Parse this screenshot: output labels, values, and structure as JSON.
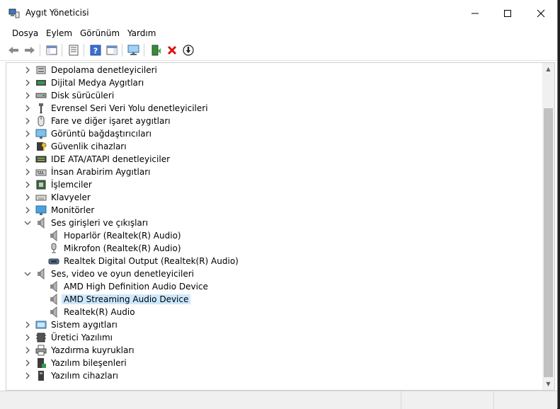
{
  "window": {
    "title": "Aygıt Yöneticisi"
  },
  "menu": {
    "items": [
      "Dosya",
      "Eylem",
      "Görünüm",
      "Yardım"
    ]
  },
  "toolbar": {
    "icons": [
      "back-icon",
      "forward-icon",
      "show-hide-tree-icon",
      "properties-icon",
      "help-icon",
      "action-pane-icon",
      "monitor-icon",
      "update-driver-icon",
      "uninstall-icon",
      "disable-device-icon"
    ]
  },
  "tree": {
    "items": [
      {
        "label": "Depolama denetleyicileri",
        "level": 0,
        "expanded": false,
        "icon": "storage-controller-icon"
      },
      {
        "label": "Dijital Medya Aygıtları",
        "level": 0,
        "expanded": false,
        "icon": "digital-media-icon"
      },
      {
        "label": "Disk sürücüleri",
        "level": 0,
        "expanded": false,
        "icon": "disk-drive-icon"
      },
      {
        "label": "Evrensel Seri Veri Yolu denetleyicileri",
        "level": 0,
        "expanded": false,
        "icon": "usb-icon"
      },
      {
        "label": "Fare ve diğer işaret aygıtları",
        "level": 0,
        "expanded": false,
        "icon": "mouse-icon"
      },
      {
        "label": "Görüntü bağdaştırıcıları",
        "level": 0,
        "expanded": false,
        "icon": "display-adapter-icon"
      },
      {
        "label": "Güvenlik cihazları",
        "level": 0,
        "expanded": false,
        "icon": "security-device-icon"
      },
      {
        "label": "IDE ATA/ATAPI denetleyiciler",
        "level": 0,
        "expanded": false,
        "icon": "ide-controller-icon"
      },
      {
        "label": "İnsan Arabirim Aygıtları",
        "level": 0,
        "expanded": false,
        "icon": "hid-icon"
      },
      {
        "label": "İşlemciler",
        "level": 0,
        "expanded": false,
        "icon": "processor-icon"
      },
      {
        "label": "Klavyeler",
        "level": 0,
        "expanded": false,
        "icon": "keyboard-icon"
      },
      {
        "label": "Monitörler",
        "level": 0,
        "expanded": false,
        "icon": "monitor-icon"
      },
      {
        "label": "Ses girişleri ve çıkışları",
        "level": 0,
        "expanded": true,
        "icon": "speaker-icon"
      },
      {
        "label": "Hoparlör (Realtek(R) Audio)",
        "level": 1,
        "icon": "speaker-icon"
      },
      {
        "label": "Mikrofon (Realtek(R) Audio)",
        "level": 1,
        "icon": "microphone-icon"
      },
      {
        "label": "Realtek Digital Output (Realtek(R) Audio)",
        "level": 1,
        "icon": "digital-output-icon"
      },
      {
        "label": "Ses, video ve oyun denetleyicileri",
        "level": 0,
        "expanded": true,
        "icon": "speaker-icon"
      },
      {
        "label": "AMD High Definition Audio Device",
        "level": 1,
        "icon": "speaker-icon"
      },
      {
        "label": "AMD Streaming Audio Device",
        "level": 1,
        "icon": "speaker-icon",
        "selected": true
      },
      {
        "label": "Realtek(R) Audio",
        "level": 1,
        "icon": "speaker-icon"
      },
      {
        "label": "Sistem aygıtları",
        "level": 0,
        "expanded": false,
        "icon": "system-device-icon"
      },
      {
        "label": "Üretici Yazılımı",
        "level": 0,
        "expanded": false,
        "icon": "firmware-icon"
      },
      {
        "label": "Yazdırma kuyrukları",
        "level": 0,
        "expanded": false,
        "icon": "printer-icon"
      },
      {
        "label": "Yazılım bileşenleri",
        "level": 0,
        "expanded": false,
        "icon": "software-component-icon"
      },
      {
        "label": "Yazılım cihazları",
        "level": 0,
        "expanded": false,
        "icon": "software-device-icon"
      }
    ]
  },
  "colors": {
    "selection": "#cce8ff",
    "scrollbar_thumb": "#c1c1c1"
  }
}
